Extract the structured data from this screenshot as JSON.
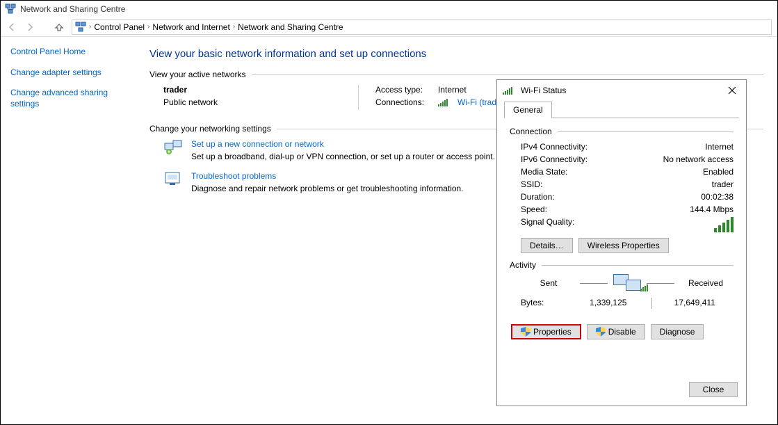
{
  "titlebar": {
    "title": "Network and Sharing Centre"
  },
  "breadcrumb": {
    "items": [
      "Control Panel",
      "Network and Internet",
      "Network and Sharing Centre"
    ]
  },
  "sidebar": {
    "home": "Control Panel Home",
    "links": [
      "Change adapter settings",
      "Change advanced sharing settings"
    ]
  },
  "content": {
    "heading": "View your basic network information and set up connections",
    "active_label": "View your active networks",
    "network": {
      "name": "trader",
      "type": "Public network",
      "access_k": "Access type:",
      "access_v": "Internet",
      "conn_k": "Connections:",
      "conn_v": "Wi-Fi (trader)"
    },
    "settings_label": "Change your networking settings",
    "actions": [
      {
        "title": "Set up a new connection or network",
        "desc": "Set up a broadband, dial-up or VPN connection, or set up a router or access point."
      },
      {
        "title": "Troubleshoot problems",
        "desc": "Diagnose and repair network problems or get troubleshooting information."
      }
    ]
  },
  "dialog": {
    "title": "Wi-Fi Status",
    "tab": "General",
    "groups": {
      "connection": "Connection",
      "activity": "Activity"
    },
    "rows": {
      "ipv4_k": "IPv4 Connectivity:",
      "ipv4_v": "Internet",
      "ipv6_k": "IPv6 Connectivity:",
      "ipv6_v": "No network access",
      "media_k": "Media State:",
      "media_v": "Enabled",
      "ssid_k": "SSID:",
      "ssid_v": "trader",
      "dur_k": "Duration:",
      "dur_v": "00:02:38",
      "speed_k": "Speed:",
      "speed_v": "144.4 Mbps",
      "sig_k": "Signal Quality:"
    },
    "buttons": {
      "details": "Details…",
      "wireless": "Wireless Properties",
      "properties": "Properties",
      "disable": "Disable",
      "diagnose": "Diagnose",
      "close": "Close"
    },
    "activity": {
      "sent_label": "Sent",
      "received_label": "Received",
      "bytes_label": "Bytes:",
      "sent": "1,339,125",
      "received": "17,649,411"
    }
  }
}
